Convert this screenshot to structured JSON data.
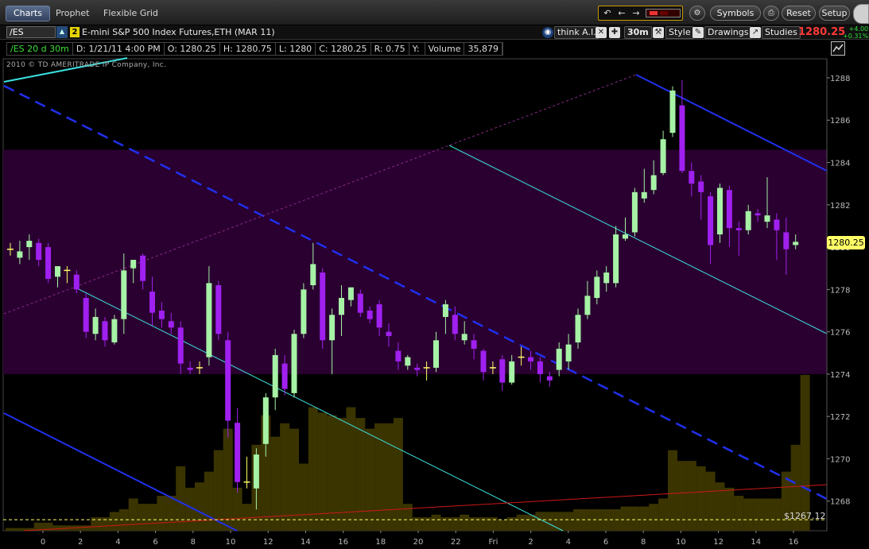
{
  "topbar": {
    "tabs": [
      {
        "label": "Charts",
        "active": true
      },
      {
        "label": "Prophet",
        "active": false
      },
      {
        "label": "Flexible Grid",
        "active": false
      }
    ],
    "symbols_label": "Symbols",
    "reset_label": "Reset",
    "setup_label": "Setup",
    "nav_icons": [
      "undo-icon",
      "back-arrow-icon",
      "forward-arrow-icon"
    ]
  },
  "symbol_bar": {
    "symbol": "/ES",
    "link_group": "2",
    "instrument": "E-mini S&P 500 Index Futures,ETH (MAR 11)",
    "think_ai_label": "think A.I.",
    "timeframe_label": "30m",
    "style_label": "Style",
    "drawings_label": "Drawings",
    "studies_label": "Studies",
    "last_price": "1280.25",
    "net_change": "+4.00",
    "net_change_pct": "+0.31%"
  },
  "info_bar": {
    "chart_label": "/ES 20 d 30m",
    "date": "D: 1/21/11 4:00 PM",
    "open": "O: 1280.25",
    "high": "H: 1280.75",
    "low": "L: 1280",
    "close": "C: 1280.25",
    "range": "R: 0.75",
    "y_label": "Y:",
    "volume_label": "Volume",
    "volume": "35,879"
  },
  "copyright": "2010 © TD AMERITRADE IP Company, Inc.",
  "price_badge": "1280.25",
  "reference_price": "$1267.12",
  "colors": {
    "up_candle": "#a6f2a6",
    "down_candle": "#a020f0",
    "doji": "#ffff66",
    "volume": "#3a3400",
    "band": "#2a0030",
    "channel_blue": "#2030ee",
    "channel_cyan": "#3ce0e0",
    "trend_red": "#d01818",
    "last_price": "#ff3838"
  },
  "chart_data": {
    "type": "candlestick",
    "ylim": [
      1266.6,
      1288.9
    ],
    "y_ticks": [
      "1288",
      "1286",
      "1284",
      "1282",
      "1280",
      "1278",
      "1276",
      "1274",
      "1272",
      "1270",
      "1268"
    ],
    "x_ticks": [
      "0",
      "2",
      "4",
      "6",
      "8",
      "10",
      "12",
      "14",
      "16",
      "18",
      "20",
      "22",
      "Fri",
      "2",
      "4",
      "6",
      "8",
      "10",
      "12",
      "14",
      "16"
    ],
    "shaded_band": [
      1274,
      1284.6
    ],
    "reference_price": 1267.12,
    "bars": [
      {
        "o": 1279.9,
        "h": 1280.2,
        "l": 1279.6,
        "c": 1279.9
      },
      {
        "o": 1279.5,
        "h": 1280.3,
        "l": 1279.2,
        "c": 1279.8
      },
      {
        "o": 1280.0,
        "h": 1280.6,
        "l": 1279.4,
        "c": 1280.3
      },
      {
        "o": 1280.2,
        "h": 1280.4,
        "l": 1279.1,
        "c": 1279.4
      },
      {
        "o": 1280.0,
        "h": 1280.2,
        "l": 1278.3,
        "c": 1278.5
      },
      {
        "o": 1278.6,
        "h": 1279.1,
        "l": 1278.1,
        "c": 1279.1
      },
      {
        "o": 1278.9,
        "h": 1279.1,
        "l": 1278.3,
        "c": 1278.9
      },
      {
        "o": 1278.7,
        "h": 1278.9,
        "l": 1277.8,
        "c": 1278.0
      },
      {
        "o": 1277.6,
        "h": 1277.8,
        "l": 1275.7,
        "c": 1276.0
      },
      {
        "o": 1275.9,
        "h": 1277.1,
        "l": 1275.6,
        "c": 1276.7
      },
      {
        "o": 1276.5,
        "h": 1276.7,
        "l": 1275.3,
        "c": 1275.6
      },
      {
        "o": 1275.5,
        "h": 1276.8,
        "l": 1275.4,
        "c": 1276.6
      },
      {
        "o": 1276.6,
        "h": 1279.7,
        "l": 1275.9,
        "c": 1278.9
      },
      {
        "o": 1279.0,
        "h": 1279.4,
        "l": 1278.3,
        "c": 1279.4
      },
      {
        "o": 1279.6,
        "h": 1279.7,
        "l": 1278.0,
        "c": 1278.4
      },
      {
        "o": 1277.9,
        "h": 1278.6,
        "l": 1276.3,
        "c": 1276.9
      },
      {
        "o": 1277.0,
        "h": 1277.4,
        "l": 1276.2,
        "c": 1276.6
      },
      {
        "o": 1276.5,
        "h": 1276.9,
        "l": 1275.9,
        "c": 1276.2
      },
      {
        "o": 1276.2,
        "h": 1276.5,
        "l": 1274.0,
        "c": 1274.5
      },
      {
        "o": 1274.3,
        "h": 1274.6,
        "l": 1274.0,
        "c": 1274.2
      },
      {
        "o": 1274.3,
        "h": 1274.6,
        "l": 1274.0,
        "c": 1274.3
      },
      {
        "o": 1274.8,
        "h": 1279.1,
        "l": 1274.4,
        "c": 1278.3
      },
      {
        "o": 1278.2,
        "h": 1278.4,
        "l": 1275.6,
        "c": 1275.9
      },
      {
        "o": 1275.6,
        "h": 1276.0,
        "l": 1271.0,
        "c": 1271.8
      },
      {
        "o": 1271.7,
        "h": 1272.4,
        "l": 1268.4,
        "c": 1268.9
      },
      {
        "o": 1268.9,
        "h": 1270.1,
        "l": 1268.6,
        "c": 1268.9
      },
      {
        "o": 1268.6,
        "h": 1270.5,
        "l": 1267.6,
        "c": 1270.2
      },
      {
        "o": 1270.7,
        "h": 1273.1,
        "l": 1270.1,
        "c": 1272.9
      },
      {
        "o": 1272.9,
        "h": 1275.2,
        "l": 1272.3,
        "c": 1274.9
      },
      {
        "o": 1274.5,
        "h": 1274.9,
        "l": 1273.0,
        "c": 1273.3
      },
      {
        "o": 1273.1,
        "h": 1276.1,
        "l": 1272.9,
        "c": 1275.9
      },
      {
        "o": 1275.9,
        "h": 1278.3,
        "l": 1275.7,
        "c": 1278.0
      },
      {
        "o": 1278.2,
        "h": 1280.2,
        "l": 1278.0,
        "c": 1279.2
      },
      {
        "o": 1278.8,
        "h": 1279.0,
        "l": 1275.2,
        "c": 1275.6
      },
      {
        "o": 1275.6,
        "h": 1277.1,
        "l": 1274.0,
        "c": 1276.8
      },
      {
        "o": 1276.8,
        "h": 1278.2,
        "l": 1275.8,
        "c": 1277.6
      },
      {
        "o": 1277.5,
        "h": 1278.1,
        "l": 1277.2,
        "c": 1278.1
      },
      {
        "o": 1277.8,
        "h": 1278.0,
        "l": 1276.7,
        "c": 1276.9
      },
      {
        "o": 1277.0,
        "h": 1277.2,
        "l": 1276.4,
        "c": 1276.6
      },
      {
        "o": 1277.3,
        "h": 1277.5,
        "l": 1275.8,
        "c": 1276.2
      },
      {
        "o": 1276.0,
        "h": 1276.4,
        "l": 1275.3,
        "c": 1275.8
      },
      {
        "o": 1275.1,
        "h": 1275.5,
        "l": 1274.2,
        "c": 1274.6
      },
      {
        "o": 1274.4,
        "h": 1274.9,
        "l": 1274.2,
        "c": 1274.8
      },
      {
        "o": 1274.3,
        "h": 1274.5,
        "l": 1273.9,
        "c": 1274.2
      },
      {
        "o": 1274.3,
        "h": 1274.6,
        "l": 1273.7,
        "c": 1274.3
      },
      {
        "o": 1274.3,
        "h": 1276.0,
        "l": 1274.1,
        "c": 1275.6
      },
      {
        "o": 1276.7,
        "h": 1277.5,
        "l": 1275.9,
        "c": 1277.3
      },
      {
        "o": 1276.8,
        "h": 1277.2,
        "l": 1275.6,
        "c": 1275.9
      },
      {
        "o": 1275.6,
        "h": 1276.5,
        "l": 1275.4,
        "c": 1275.9
      },
      {
        "o": 1275.6,
        "h": 1275.9,
        "l": 1274.7,
        "c": 1275.2
      },
      {
        "o": 1275.1,
        "h": 1275.2,
        "l": 1273.7,
        "c": 1274.1
      },
      {
        "o": 1274.3,
        "h": 1274.6,
        "l": 1274.0,
        "c": 1274.3
      },
      {
        "o": 1274.7,
        "h": 1274.9,
        "l": 1273.2,
        "c": 1273.6
      },
      {
        "o": 1273.6,
        "h": 1274.9,
        "l": 1273.5,
        "c": 1274.6
      },
      {
        "o": 1274.8,
        "h": 1275.3,
        "l": 1274.4,
        "c": 1274.8
      },
      {
        "o": 1274.8,
        "h": 1275.1,
        "l": 1274.2,
        "c": 1274.6
      },
      {
        "o": 1274.6,
        "h": 1274.8,
        "l": 1273.6,
        "c": 1274.0
      },
      {
        "o": 1273.9,
        "h": 1274.1,
        "l": 1273.4,
        "c": 1273.7
      },
      {
        "o": 1274.2,
        "h": 1275.5,
        "l": 1273.9,
        "c": 1275.2
      },
      {
        "o": 1274.6,
        "h": 1275.9,
        "l": 1274.2,
        "c": 1275.4
      },
      {
        "o": 1275.5,
        "h": 1277.1,
        "l": 1275.2,
        "c": 1276.8
      },
      {
        "o": 1276.8,
        "h": 1278.4,
        "l": 1276.6,
        "c": 1277.7
      },
      {
        "o": 1277.6,
        "h": 1278.9,
        "l": 1277.3,
        "c": 1278.6
      },
      {
        "o": 1278.3,
        "h": 1279.1,
        "l": 1277.9,
        "c": 1278.8
      },
      {
        "o": 1278.3,
        "h": 1281.0,
        "l": 1278.1,
        "c": 1280.6
      },
      {
        "o": 1280.4,
        "h": 1281.4,
        "l": 1280.3,
        "c": 1280.6
      },
      {
        "o": 1280.7,
        "h": 1282.8,
        "l": 1280.5,
        "c": 1282.6
      },
      {
        "o": 1282.3,
        "h": 1283.7,
        "l": 1282.1,
        "c": 1282.6
      },
      {
        "o": 1282.7,
        "h": 1284.1,
        "l": 1282.5,
        "c": 1283.4
      },
      {
        "o": 1283.5,
        "h": 1285.5,
        "l": 1283.4,
        "c": 1285.1
      },
      {
        "o": 1285.4,
        "h": 1287.6,
        "l": 1285.2,
        "c": 1287.4
      },
      {
        "o": 1286.7,
        "h": 1287.9,
        "l": 1283.5,
        "c": 1283.6
      },
      {
        "o": 1283.6,
        "h": 1284.0,
        "l": 1282.4,
        "c": 1283.0
      },
      {
        "o": 1283.1,
        "h": 1283.4,
        "l": 1281.3,
        "c": 1282.6
      },
      {
        "o": 1282.4,
        "h": 1282.6,
        "l": 1279.2,
        "c": 1280.1
      },
      {
        "o": 1280.6,
        "h": 1283.0,
        "l": 1280.2,
        "c": 1282.8
      },
      {
        "o": 1282.7,
        "h": 1282.9,
        "l": 1280.0,
        "c": 1280.9
      },
      {
        "o": 1280.9,
        "h": 1281.2,
        "l": 1279.6,
        "c": 1280.8
      },
      {
        "o": 1280.8,
        "h": 1282.0,
        "l": 1280.6,
        "c": 1281.7
      },
      {
        "o": 1281.6,
        "h": 1281.8,
        "l": 1281.2,
        "c": 1281.5
      },
      {
        "o": 1281.2,
        "h": 1283.3,
        "l": 1280.9,
        "c": 1281.5
      },
      {
        "o": 1281.3,
        "h": 1281.6,
        "l": 1279.4,
        "c": 1280.8
      },
      {
        "o": 1280.7,
        "h": 1281.4,
        "l": 1278.7,
        "c": 1279.9
      },
      {
        "o": 1280.1,
        "h": 1280.6,
        "l": 1279.9,
        "c": 1280.25
      }
    ],
    "volume_bar_heights": [
      0.01,
      0.01,
      0.01,
      0.03,
      0.03,
      0.02,
      0.02,
      0.02,
      0.02,
      0.05,
      0.05,
      0.07,
      0.08,
      0.12,
      0.1,
      0.1,
      0.13,
      0.13,
      0.24,
      0.16,
      0.18,
      0.22,
      0.3,
      0.38,
      0.16,
      0.1,
      0.32,
      0.43,
      0.35,
      0.4,
      0.38,
      0.25,
      0.46,
      0.44,
      0.43,
      0.42,
      0.46,
      0.42,
      0.38,
      0.4,
      0.4,
      0.42,
      0.1,
      0.05,
      0.05,
      0.06,
      0.05,
      0.05,
      0.06,
      0.05,
      0.05,
      0.05,
      0.04,
      0.05,
      0.06,
      0.06,
      0.07,
      0.07,
      0.07,
      0.07,
      0.08,
      0.08,
      0.08,
      0.08,
      0.08,
      0.09,
      0.09,
      0.09,
      0.1,
      0.12,
      0.3,
      0.26,
      0.26,
      0.24,
      0.22,
      0.18,
      0.16,
      0.13,
      0.12,
      0.12,
      0.12,
      0.12,
      0.22,
      0.32,
      0.58
    ]
  }
}
